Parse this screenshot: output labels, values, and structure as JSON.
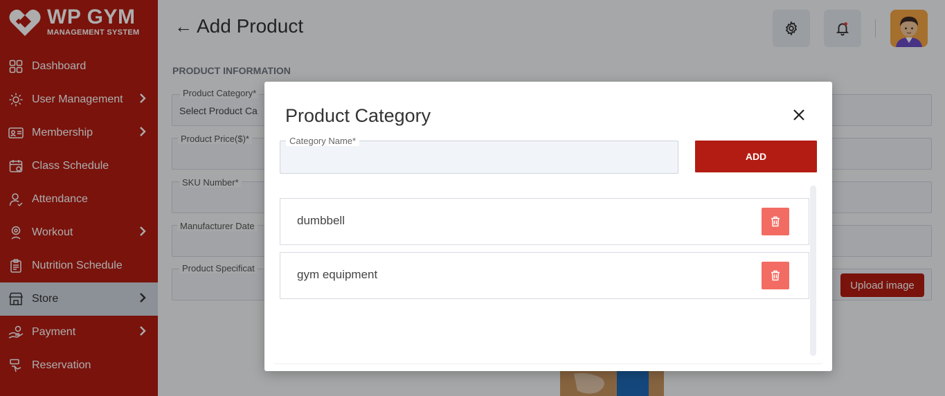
{
  "brand": {
    "title": "WP GYM",
    "subtitle": "MANAGEMENT SYSTEM"
  },
  "sidebar": {
    "items": [
      {
        "label": "Dashboard",
        "icon": "grid-icon",
        "has_submenu": false
      },
      {
        "label": "User Management",
        "icon": "users-gear-icon",
        "has_submenu": true
      },
      {
        "label": "Membership",
        "icon": "id-card-icon",
        "has_submenu": true
      },
      {
        "label": "Class Schedule",
        "icon": "calendar-icon",
        "has_submenu": false
      },
      {
        "label": "Attendance",
        "icon": "user-check-icon",
        "has_submenu": false
      },
      {
        "label": "Workout",
        "icon": "workout-icon",
        "has_submenu": true
      },
      {
        "label": "Nutrition Schedule",
        "icon": "clipboard-icon",
        "has_submenu": false
      },
      {
        "label": "Store",
        "icon": "store-icon",
        "has_submenu": true,
        "active": true
      },
      {
        "label": "Payment",
        "icon": "hand-money-icon",
        "has_submenu": true
      },
      {
        "label": "Reservation",
        "icon": "reservation-icon",
        "has_submenu": false
      }
    ]
  },
  "header": {
    "back_arrow": "←",
    "title": "Add Product"
  },
  "form": {
    "section_title": "PRODUCT INFORMATION",
    "category_label": "Product Category*",
    "category_value": "Select Product Ca",
    "price_label": "Product Price($)*",
    "sku_label": "SKU Number*",
    "manufacturer_label": "Manufacturer Date",
    "spec_label": "Product Specificat",
    "upload_label": "Upload image"
  },
  "modal": {
    "title": "Product Category",
    "input_label": "Category Name*",
    "input_value": "",
    "add_label": "ADD",
    "categories": [
      {
        "name": "dumbbell"
      },
      {
        "name": "gym equipment"
      }
    ]
  },
  "colors": {
    "brand_red": "#b31c12",
    "delete_red": "#f26c63",
    "active_item_bg": "#ced5df"
  }
}
